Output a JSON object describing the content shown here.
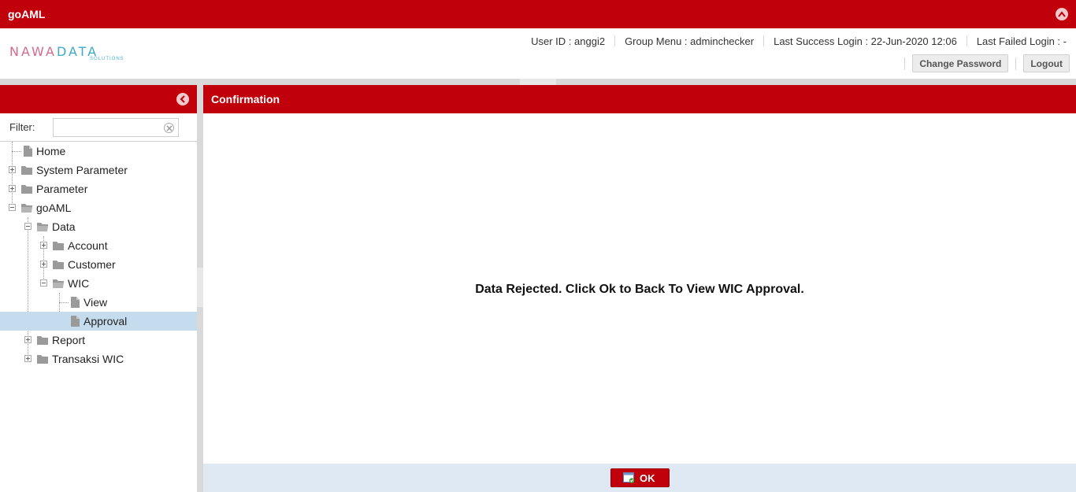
{
  "app": {
    "title": "goAML"
  },
  "header": {
    "logo_main_1": "NAWA",
    "logo_main_2": "DATA",
    "logo_sub": "SOLUTIONS",
    "user_id": "User ID : anggi2",
    "group_menu": "Group Menu : adminchecker",
    "last_success": "Last Success Login : 22-Jun-2020 12:06",
    "last_failed": "Last Failed Login : -",
    "change_password": "Change Password",
    "logout": "Logout"
  },
  "sidebar": {
    "filter_label": "Filter:",
    "filter_value": "",
    "items": [
      {
        "label": "Home"
      },
      {
        "label": "System Parameter"
      },
      {
        "label": "Parameter"
      },
      {
        "label": "goAML"
      },
      {
        "label": "Data"
      },
      {
        "label": "Account"
      },
      {
        "label": "Customer"
      },
      {
        "label": "WIC"
      },
      {
        "label": "View"
      },
      {
        "label": "Approval",
        "selected": true
      },
      {
        "label": "Report"
      },
      {
        "label": "Transaksi WIC"
      }
    ]
  },
  "main": {
    "title": "Confirmation",
    "message": "Data Rejected. Click Ok to Back To View WIC Approval.",
    "ok_label": "OK"
  },
  "colors": {
    "brand_red": "#c0000b",
    "selected_row": "#c5dcef",
    "footer_bg": "#dfe9f4"
  },
  "icons": {
    "page": "page-icon",
    "folder": "folder-icon",
    "folder_open": "folder-open-icon",
    "expand": "plus-icon",
    "collapse": "minus-icon"
  }
}
